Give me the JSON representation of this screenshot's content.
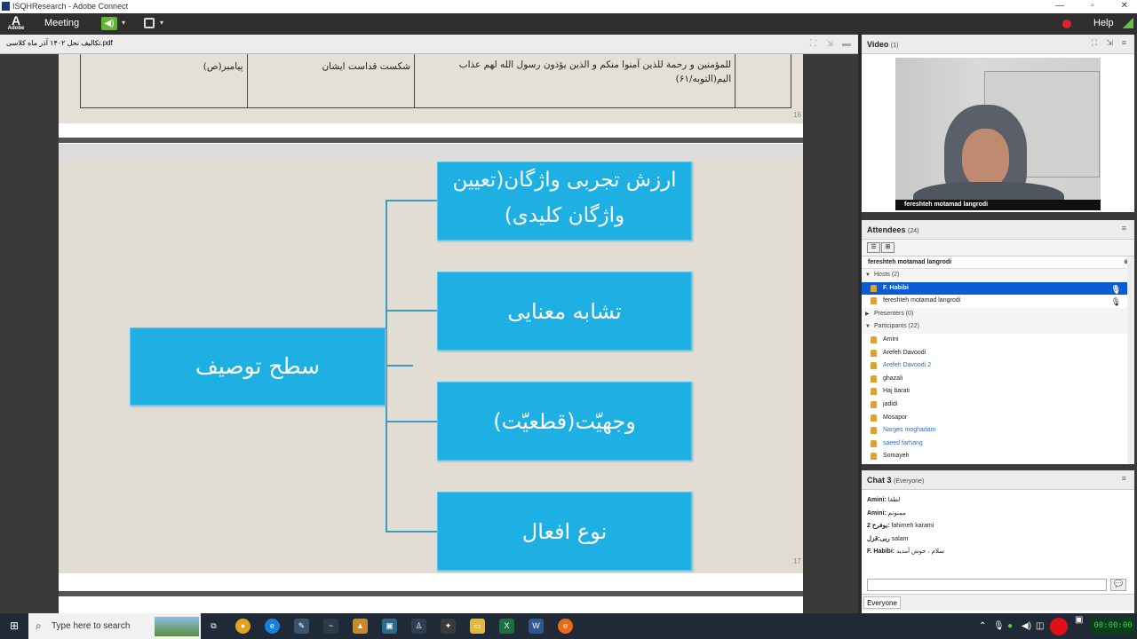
{
  "window": {
    "title": "ISQHResearch - Adobe Connect",
    "min": "—",
    "max": "▫",
    "close": "✕"
  },
  "menubar": {
    "logo": "Adobe",
    "meeting": "Meeting",
    "help": "Help"
  },
  "share": {
    "filename": "تکالیف نحل ۱۴۰۲ آذر ماه کلاسی.pdf",
    "page1": {
      "col_right": "پیامبر(ص)",
      "col_mid": "شکست قداست ایشان",
      "col_main": "للمؤمنین و رحمة للذین آمنوا منکم و الذین یؤذون رسول الله لهم عذاب الیم(التوبه/۶۱)",
      "page_no": "16"
    },
    "slide": {
      "center": "سطح توصیف",
      "items": [
        "ارزش تجربی واژگان(تعیین واژگان کلیدی)",
        "تشابه معنایی",
        "وجهیّت(قطعیّت)",
        "نوع افعال"
      ],
      "page_no": "17"
    }
  },
  "video": {
    "title": "Video",
    "count": "(1)",
    "name": "fereshteh motamad langrodi"
  },
  "attendees": {
    "title": "Attendees",
    "count": "(24)",
    "self": "fereshteh motamad langrodi",
    "hosts_label": "Hosts (2)",
    "hosts": [
      "F. Habibi",
      "fereshteh motamad langrodi"
    ],
    "presenters_label": "Presenters (0)",
    "participants_label": "Participants (22)",
    "participants": [
      "Amini",
      "Arefeh Davoodi",
      "Arefeh Davoodi 2",
      "ghazali",
      "Haj barati",
      "jadidi",
      "Mosapor",
      "Narges moghadam",
      "saeed farhang",
      "Somayeh"
    ]
  },
  "chat": {
    "title": "Chat 3",
    "scope": "(Everyone)",
    "messages": [
      {
        "from": "Amini:",
        "text": "لطفا"
      },
      {
        "from": "Amini:",
        "text": "ممنونم"
      },
      {
        "from": "یوفرخ 2:",
        "text": "fahimeh karami"
      },
      {
        "from": "ربی:قزل",
        "text": "salam"
      },
      {
        "from": "F. Habibi:",
        "text": "سلام ، خوش آمدید"
      }
    ],
    "audience": "Everyone"
  },
  "taskbar": {
    "search_placeholder": "Type here to search",
    "clock": "00:00:00"
  }
}
